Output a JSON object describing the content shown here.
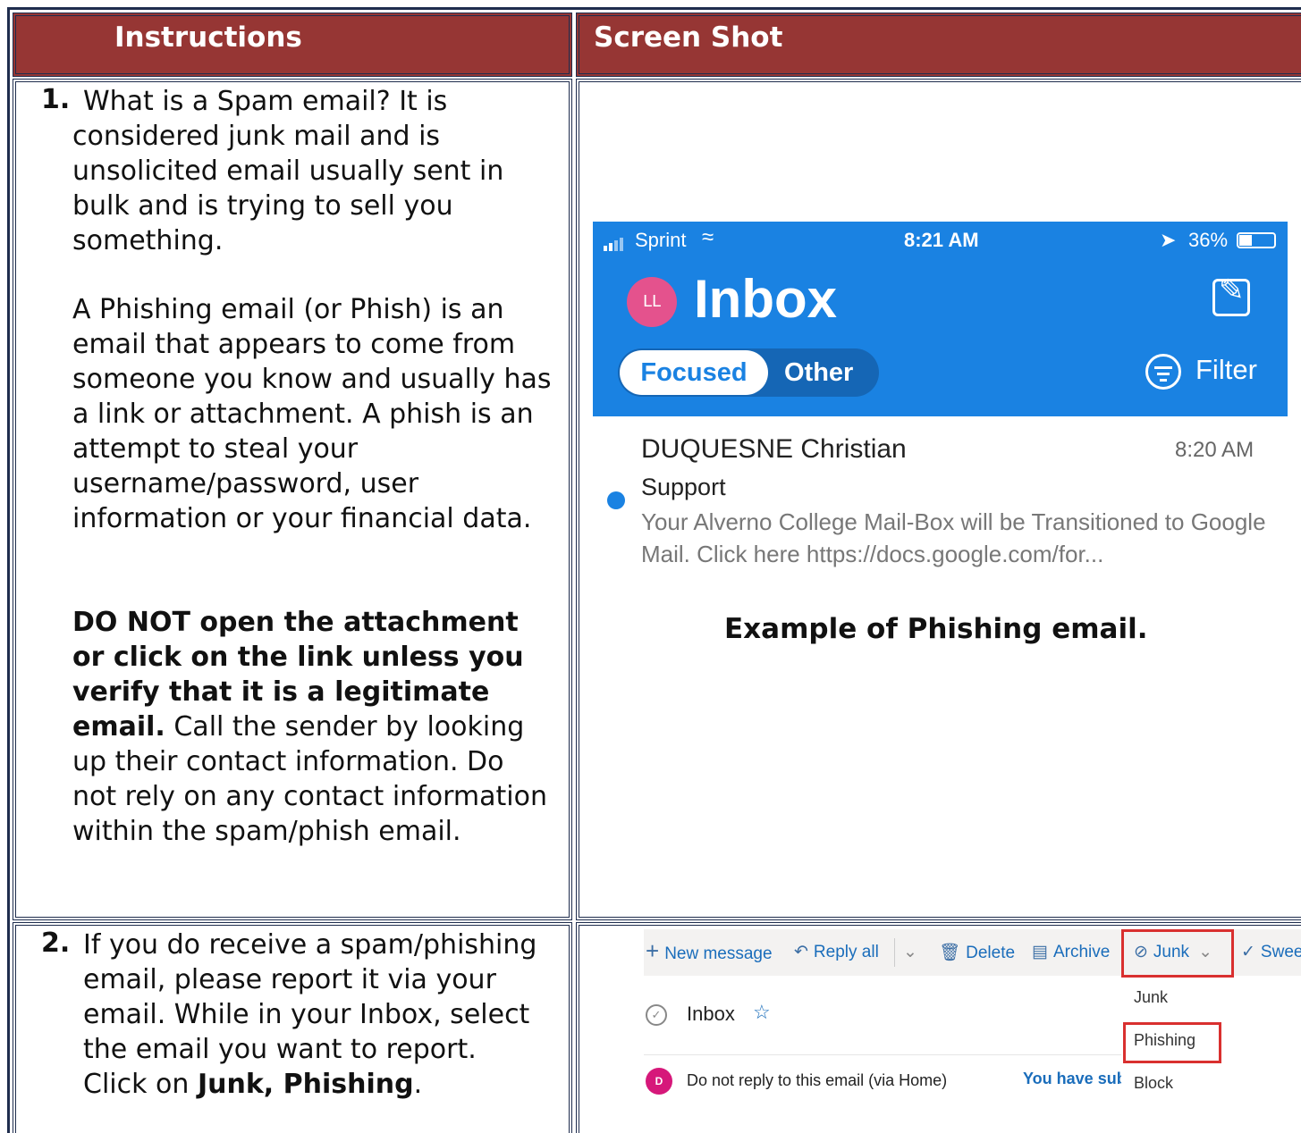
{
  "table": {
    "header_instructions": "Instructions",
    "header_screenshot": "Screen Shot"
  },
  "step1": {
    "number": "1.",
    "para1": "What is a Spam email?  It is considered junk mail and is unsolicited email usually sent in bulk and is trying to sell you something.",
    "para2": "A Phishing email (or Phish) is an email that appears to come from someone you know and usually has a link or attachment. A phish is an attempt to steal your username/password, user information or your financial data.",
    "para3_bold": "DO NOT open the attachment or click on the link unless you verify that it is a legitimate email.",
    "para3_rest": "  Call the sender by looking up their contact information.  Do not rely on any contact information within the spam/phish email."
  },
  "phone": {
    "carrier": "Sprint",
    "time": "8:21 AM",
    "battery": "36%",
    "avatar_initials": "LL",
    "title": "Inbox",
    "tab_focused": "Focused",
    "tab_other": "Other",
    "filter_label": "Filter",
    "email": {
      "sender": "DUQUESNE Christian",
      "time": "8:20 AM",
      "subject": "Support",
      "preview": "Your Alverno College Mail-Box will be Transitioned to Google Mail. Click here https://docs.google.com/for..."
    },
    "caption": "Example of Phishing email."
  },
  "step2": {
    "number": "2.",
    "text": "If you do receive a spam/phishing email, please report it via your email.  While in your Inbox, select the email you want to report.  Click on ",
    "bold": "Junk, Phishing",
    "end": "."
  },
  "outlook": {
    "new_message": "New message",
    "reply_all": "Reply all",
    "delete": "Delete",
    "archive": "Archive",
    "junk": "Junk",
    "sweep": "Swee",
    "folder": "Inbox",
    "menu_items": [
      "Junk",
      "Phishing",
      "Block"
    ],
    "row_avatar": "D",
    "row_subject": "Do not reply to this email (via Home)",
    "row_right": "You have subı"
  },
  "colors": {
    "header_bg": "#963634",
    "border": "#1f2d4e",
    "phone_blue": "#1a82e2",
    "highlight_red": "#d9302f"
  }
}
